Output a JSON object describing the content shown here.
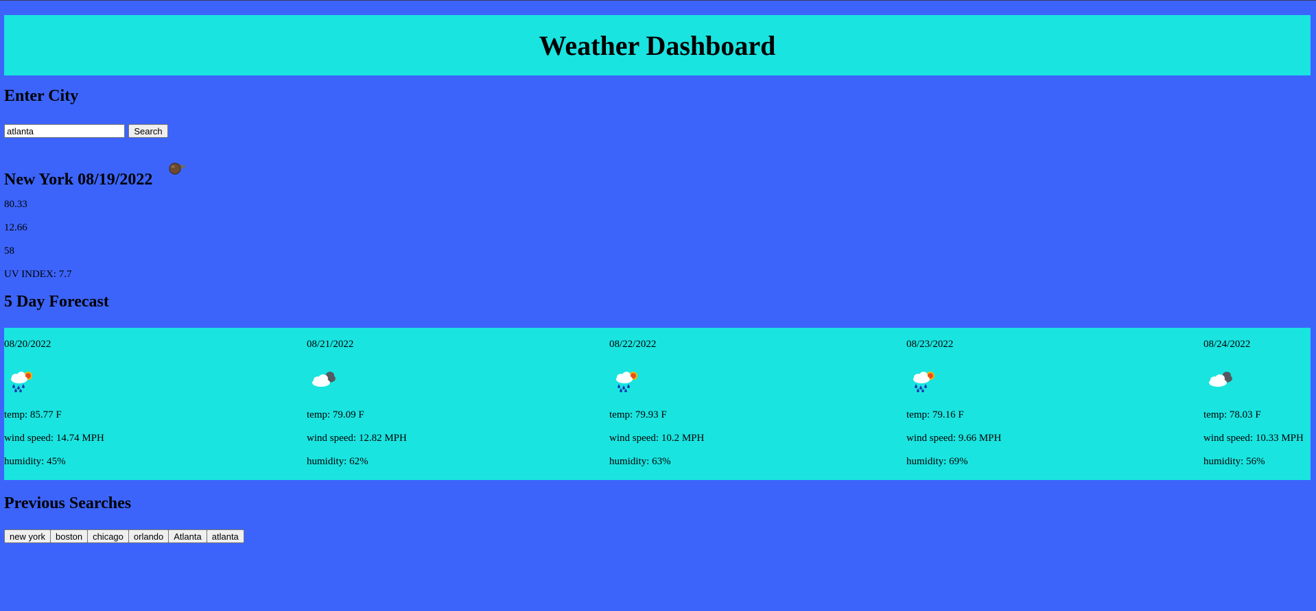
{
  "header": {
    "title": "Weather Dashboard"
  },
  "search": {
    "heading": "Enter City",
    "value": "atlanta",
    "button_label": "Search"
  },
  "current": {
    "title": "New York 08/19/2022",
    "icon": "broken-clouds-night-icon",
    "temp": "80.33",
    "wind": "12.66",
    "humidity": "58",
    "uv": "UV INDEX: 7.7"
  },
  "forecast": {
    "heading": "5 Day Forecast",
    "days": [
      {
        "date": "08/20/2022",
        "icon": "rain-sun-icon",
        "temp": "temp: 85.77 F",
        "wind": "wind speed: 14.74 MPH",
        "humidity": "humidity: 45%"
      },
      {
        "date": "08/21/2022",
        "icon": "cloudy-icon",
        "temp": "temp: 79.09 F",
        "wind": "wind speed: 12.82 MPH",
        "humidity": "humidity: 62%"
      },
      {
        "date": "08/22/2022",
        "icon": "rain-sun-icon",
        "temp": "temp: 79.93 F",
        "wind": "wind speed: 10.2 MPH",
        "humidity": "humidity: 63%"
      },
      {
        "date": "08/23/2022",
        "icon": "rain-sun-icon",
        "temp": "temp: 79.16 F",
        "wind": "wind speed: 9.66 MPH",
        "humidity": "humidity: 69%"
      },
      {
        "date": "08/24/2022",
        "icon": "cloudy-icon",
        "temp": "temp: 78.03 F",
        "wind": "wind speed: 10.33 MPH",
        "humidity": "humidity: 56%"
      }
    ]
  },
  "previous": {
    "heading": "Previous Searches",
    "items": [
      "new york",
      "boston",
      "chicago",
      "orlando",
      "Atlanta",
      "atlanta"
    ]
  },
  "colors": {
    "background": "#3c64fa",
    "panel": "#1ae4e0"
  }
}
